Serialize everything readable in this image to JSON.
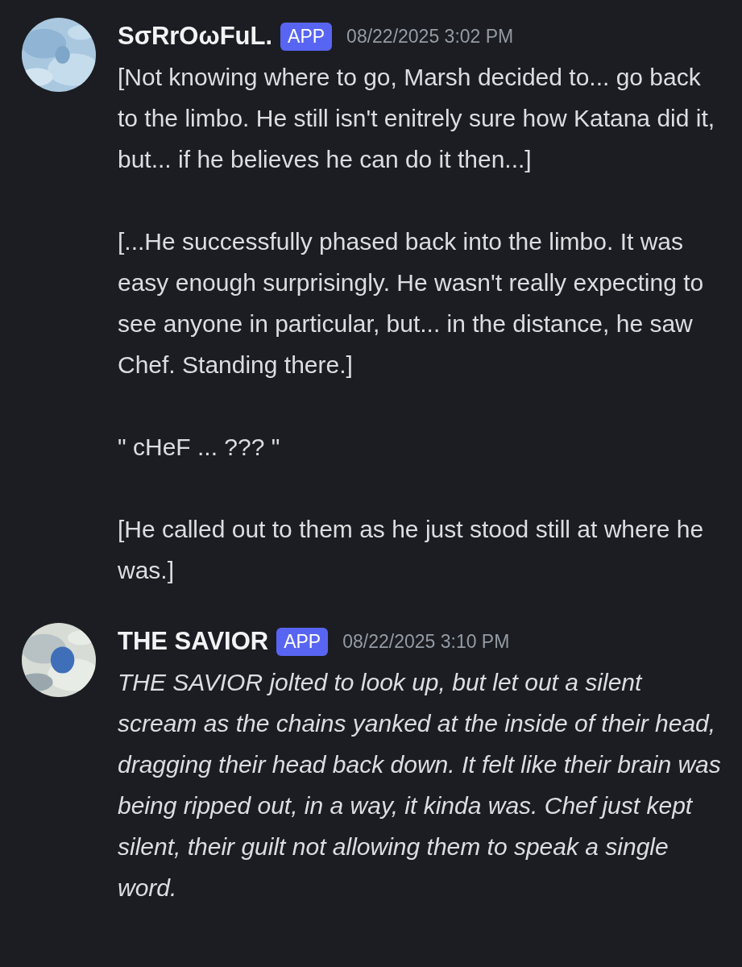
{
  "messages": [
    {
      "author": "SσRrOωFuL.",
      "badge": "APP",
      "timestamp": "08/22/2025 3:02 PM",
      "avatar": {
        "kind": "picture"
      },
      "kind": "dialogue",
      "paragraphs": [
        "[Not knowing where to go, Marsh decided to... go back to the limbo. He still isn't enitrely sure how Katana did it, but... if he believes he can do it then...]",
        "[...He successfully phased back into the limbo. It was easy enough surprisingly. He wasn't really expecting to see anyone in particular, but... in the distance, he saw Chef. Standing there.]",
        "\" cHeF ... ??? \"",
        "[He called out to them as he just stood still at where he was.]"
      ]
    },
    {
      "author": "THE SAVIOR",
      "badge": "APP",
      "timestamp": "08/22/2025 3:10 PM",
      "avatar": {
        "kind": "picture"
      },
      "kind": "narration",
      "paragraphs": [
        "THE SAVIOR jolted to look up, but let out a silent scream as the chains yanked at the inside of their head, dragging their head back down. It felt like their brain was being ripped out, in a way, it kinda was. Chef just kept silent, their guilt not allowing them to speak a single word."
      ]
    }
  ]
}
